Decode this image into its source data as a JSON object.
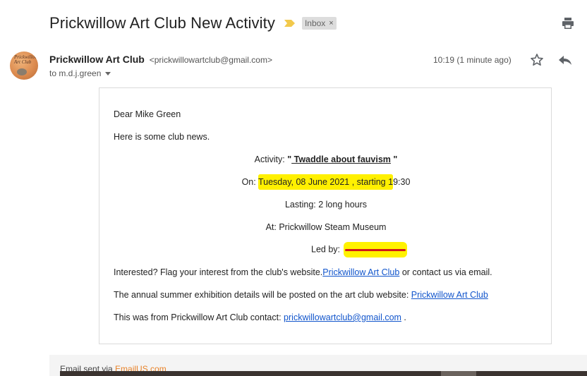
{
  "email": {
    "subject": "Prickwillow Art Club New Activity",
    "label": "Inbox",
    "label_remove": "×",
    "sender_name": "Prickwillow Art Club",
    "sender_email": "<prickwillowartclub@gmail.com>",
    "to": "to m.d.j.green",
    "timestamp": "10:19 (1 minute ago)",
    "avatar_text": "Prickwillow Art Club"
  },
  "body": {
    "greeting": "Dear Mike Green",
    "intro": "Here is some club news.",
    "activity_prefix": "Activity: ",
    "activity_open_quote": "\"",
    "activity_title": " Twaddle about fauvism",
    "activity_close_quote": " \"",
    "on_prefix": "On: ",
    "on_highlight": "Tuesday, 08 June 2021 , starting 1",
    "on_suffix": "9:30",
    "lasting": "Lasting: 2 long hours",
    "at": "At:  Prickwillow Steam Museum",
    "led_by": "Led by: ",
    "interest_text": "Interested? Flag your interest from the club's website.",
    "interest_link": "Prickwillow Art Club",
    "interest_suffix": " or contact us via email.",
    "exhibition_text": "The annual summer exhibition details will be posted on the art club website: ",
    "exhibition_link": "Prickwillow Art Club",
    "contact_text": "This was from Prickwillow Art Club contact: ",
    "contact_link": "prickwillowartclub@gmail.com",
    "contact_suffix": " ."
  },
  "footer": {
    "sent_via": "Email sent via ",
    "service": "EmailUS.com"
  },
  "colors": {
    "highlight": "#fff200",
    "redaction_line": "#d21a1a",
    "link": "#1155cc",
    "footer_brand": "#e8832a"
  },
  "icons": [
    "importance-marker-icon",
    "print-icon",
    "star-icon",
    "reply-icon",
    "chevron-down-icon"
  ]
}
